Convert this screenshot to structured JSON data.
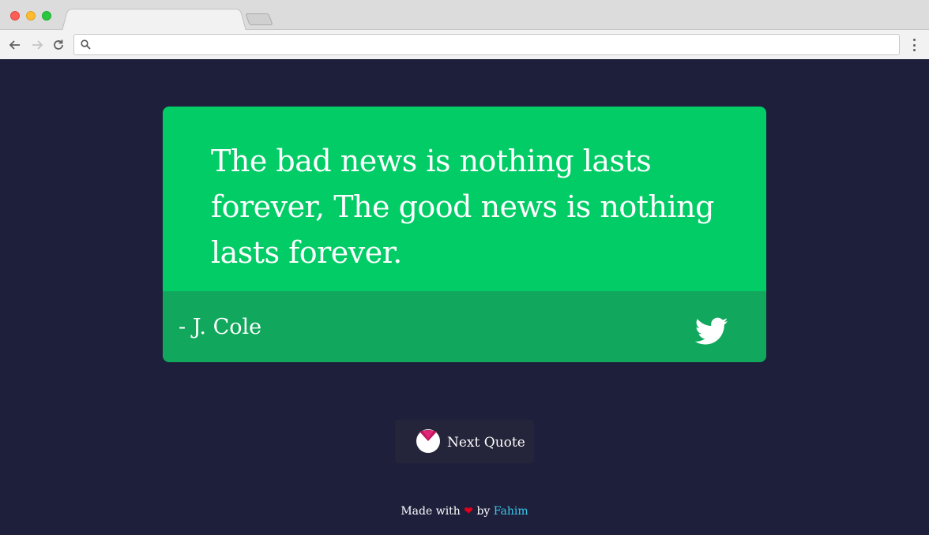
{
  "browser": {
    "tab_title": "",
    "url": ""
  },
  "quote": {
    "text": "The bad news is nothing lasts forever, The good news is nothing lasts forever.",
    "author": "- J. Cole",
    "share_icon": "twitter-icon"
  },
  "actions": {
    "next_label": "Next Quote",
    "next_icon": "flower-icon"
  },
  "footer": {
    "made_with": "Made with",
    "heart": "❤",
    "by": "by",
    "author_name": "Fahim"
  },
  "colors": {
    "background": "#1e1f3b",
    "quote_panel": "#02cc66",
    "author_panel": "#11a85d",
    "button": "#24243a",
    "link": "#3bc8e8",
    "heart": "#e3001b"
  }
}
